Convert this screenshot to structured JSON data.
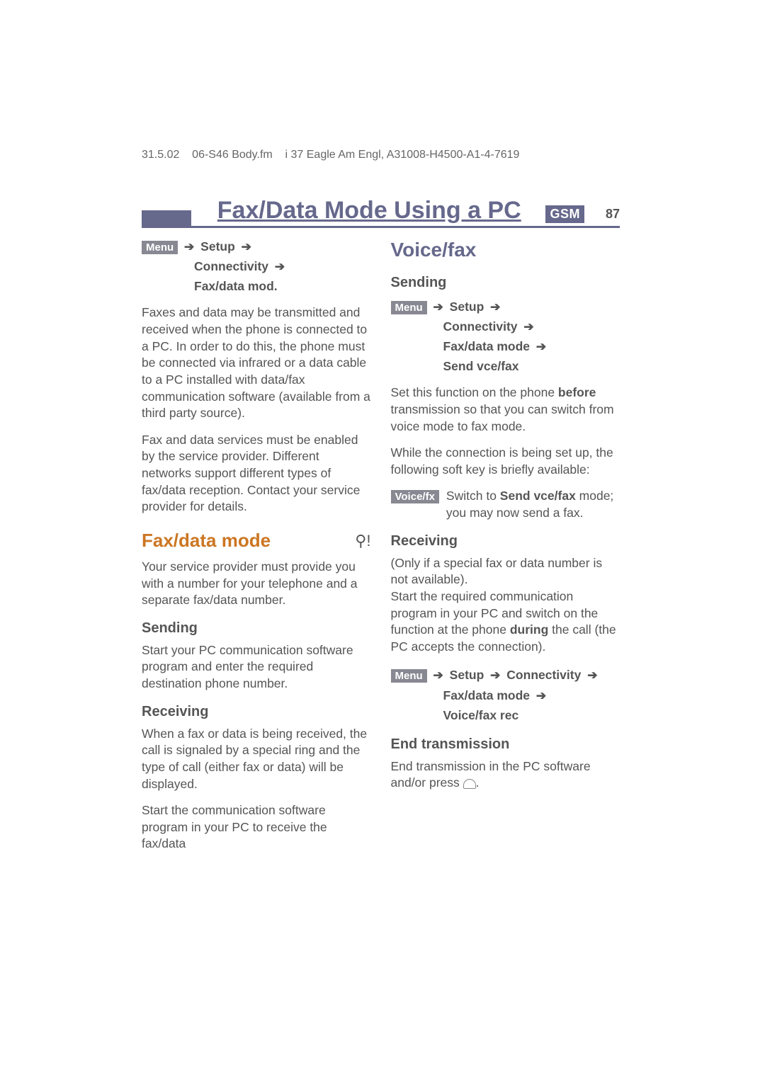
{
  "header": {
    "date": "31.5.02",
    "file": "06-S46 Body.fm",
    "part": "i 37",
    "product": "Eagle  Am Engl,",
    "code": "A31008-H4500-A1-4-7619"
  },
  "title": "Fax/Data Mode Using a PC",
  "gsm": "GSM",
  "pageNumber": "87",
  "left": {
    "nav": {
      "menu": "Menu",
      "setup": "Setup",
      "connectivity": "Connectivity",
      "faxdata": "Fax/data mod."
    },
    "p1": "Faxes and data may be transmitted and received when the phone is connected to a PC.  In order to do this, the phone must be connected via infrared or a data cable to a PC installed with data/fax communication software (available from a third party source).",
    "p2": "Fax and data services must be enabled by the service provider. Different networks support different types of fax/data reception. Contact your service provider for details.",
    "h_faxdata": "Fax/data mode",
    "icon": "⚲!",
    "p3": "Your service provider must provide you with a number for your telephone and a separate fax/data number.",
    "h_sending": "Sending",
    "p4": "Start your PC communication software program and enter the required destination phone number.",
    "h_receiving": "Receiving",
    "p5": "When a fax or data is being received, the call is signaled by a special ring and the type of call (either fax or data) will be displayed.",
    "p6": "Start the communication software program in your PC to receive the fax/data"
  },
  "right": {
    "h_voicefax": "Voice/fax",
    "h_sending": "Sending",
    "nav1": {
      "menu": "Menu",
      "setup": "Setup",
      "connectivity": "Connectivity",
      "faxmode": "Fax/data mode",
      "sendvce": "Send vce/fax"
    },
    "p1a": "Set this function on the phone ",
    "p1b": "before",
    "p1c": " transmission so that you can switch from voice mode to fax mode.",
    "p2": "While the connection is being set up, the following soft key is briefly available:",
    "voicefx_badge": "Voice/fx",
    "voicefx_text_a": "Switch to ",
    "voicefx_text_b": "Send vce/fax",
    "voicefx_text_c": " mode; you may now send a fax.",
    "h_receiving": "Receiving",
    "p3": "(Only if a special fax or data number is not available).",
    "p4a": "Start the required communication program in your PC and switch on the function at the phone ",
    "p4b": "during",
    "p4c": " the call (the PC accepts the connection).",
    "nav2": {
      "menu": "Menu",
      "setup": "Setup",
      "connectivity": "Connectivity",
      "faxmode": "Fax/data mode",
      "vfr": "Voice/fax rec"
    },
    "h_end": "End transmission",
    "p5a": "End transmission in the PC software and/or press ",
    "p5c": "."
  }
}
